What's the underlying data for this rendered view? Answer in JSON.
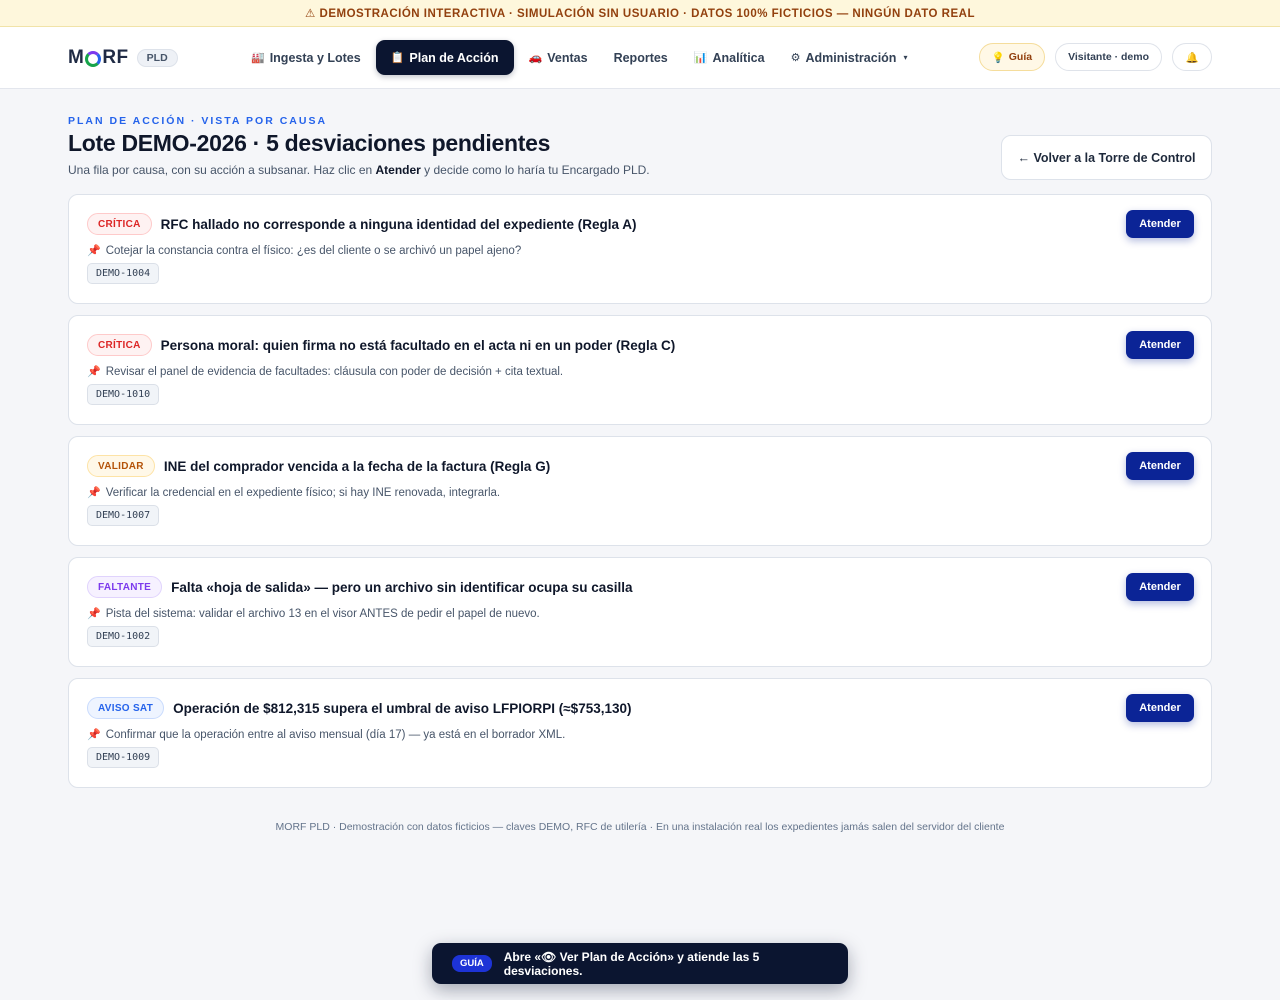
{
  "banner": {
    "text": "⚠ DEMOSTRACIÓN INTERACTIVA · SIMULACIÓN SIN USUARIO · DATOS 100% FICTICIOS — NINGÚN DATO REAL"
  },
  "brand": {
    "name_left": "M",
    "name_right": "RF",
    "tag": "PLD"
  },
  "nav": [
    {
      "icon": "🏭",
      "label": "Ingesta y Lotes"
    },
    {
      "icon": "📋",
      "label": "Plan de Acción",
      "active": true
    },
    {
      "icon": "🚗",
      "label": "Ventas"
    },
    {
      "icon": "",
      "label": "Reportes"
    },
    {
      "icon": "📊",
      "label": "Analítica"
    },
    {
      "icon": "⚙",
      "label": "Administración",
      "caret": "▾"
    }
  ],
  "tools": {
    "guide_icon": "💡",
    "guide_label": "Guía",
    "user_label": "Visitante · demo",
    "bell_icon": "🔔"
  },
  "header": {
    "eyebrow": "PLAN DE ACCIÓN · VISTA POR CAUSA",
    "title": "Lote DEMO-2026 · 5 desviaciones pendientes",
    "subtitle_pre": "Una fila por causa, con su acción a subsanar. Haz clic en ",
    "subtitle_bold": "Atender",
    "subtitle_post": " y decide como lo haría tu Encargado PLD.",
    "back_label": "← Volver a la Torre de Control"
  },
  "items": [
    {
      "badge": "CRÍTICA",
      "kind": "critica",
      "title": "RFC hallado no corresponde a ninguna identidad del expediente (Regla A)",
      "hint": "Cotejar la constancia contra el físico: ¿es del cliente o se archivó un papel ajeno?",
      "code": "DEMO-1004",
      "action": "Atender"
    },
    {
      "badge": "CRÍTICA",
      "kind": "critica",
      "title": "Persona moral: quien firma no está facultado en el acta ni en un poder (Regla C)",
      "hint": "Revisar el panel de evidencia de facultades: cláusula con poder de decisión + cita textual.",
      "code": "DEMO-1010",
      "action": "Atender"
    },
    {
      "badge": "VALIDAR",
      "kind": "validar",
      "title": "INE del comprador vencida a la fecha de la factura (Regla G)",
      "hint": "Verificar la credencial en el expediente físico; si hay INE renovada, integrarla.",
      "code": "DEMO-1007",
      "action": "Atender"
    },
    {
      "badge": "FALTANTE",
      "kind": "faltante",
      "title": "Falta «hoja de salida» — pero un archivo sin identificar ocupa su casilla",
      "hint": "Pista del sistema: validar el archivo 13 en el visor ANTES de pedir el papel de nuevo.",
      "code": "DEMO-1002",
      "action": "Atender"
    },
    {
      "badge": "AVISO SAT",
      "kind": "aviso",
      "title": "Operación de $812,315 supera el umbral de aviso LFPIORPI (≈$753,130)",
      "hint": "Confirmar que la operación entre al aviso mensual (día 17) — ya está en el borrador XML.",
      "code": "DEMO-1009",
      "action": "Atender"
    }
  ],
  "pin_icon": "📌",
  "footer": "MORF PLD · Demostración con datos ficticios — claves DEMO, RFC de utilería · En una instalación real los expedientes jamás salen del servidor del cliente",
  "toast": {
    "tag": "GUÍA",
    "message": "Abre «👁 Ver Plan de Acción» y atiende las 5 desviaciones."
  }
}
